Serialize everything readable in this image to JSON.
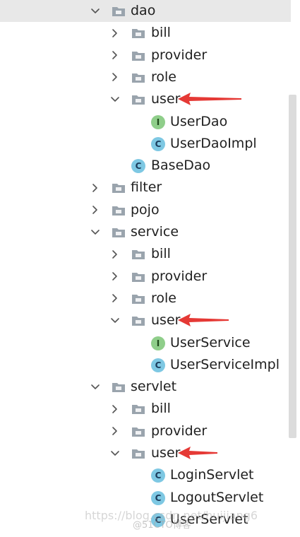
{
  "tree": {
    "nodes": [
      {
        "label": "dao",
        "kind": "folder",
        "depth": 0,
        "expanded": true,
        "selected": true
      },
      {
        "label": "bill",
        "kind": "folder",
        "depth": 1,
        "expanded": false
      },
      {
        "label": "provider",
        "kind": "folder",
        "depth": 1,
        "expanded": false
      },
      {
        "label": "role",
        "kind": "folder",
        "depth": 1,
        "expanded": false
      },
      {
        "label": "user",
        "kind": "folder",
        "depth": 1,
        "expanded": true,
        "annotated": true
      },
      {
        "label": "UserDao",
        "kind": "interface",
        "depth": 2
      },
      {
        "label": "UserDaoImpl",
        "kind": "class",
        "depth": 2
      },
      {
        "label": "BaseDao",
        "kind": "class",
        "depth": 1
      },
      {
        "label": "filter",
        "kind": "folder",
        "depth": 0,
        "expanded": false
      },
      {
        "label": "pojo",
        "kind": "folder",
        "depth": 0,
        "expanded": false
      },
      {
        "label": "service",
        "kind": "folder",
        "depth": 0,
        "expanded": true
      },
      {
        "label": "bill",
        "kind": "folder",
        "depth": 1,
        "expanded": false
      },
      {
        "label": "provider",
        "kind": "folder",
        "depth": 1,
        "expanded": false
      },
      {
        "label": "role",
        "kind": "folder",
        "depth": 1,
        "expanded": false
      },
      {
        "label": "user",
        "kind": "folder",
        "depth": 1,
        "expanded": true,
        "annotated": true
      },
      {
        "label": "UserService",
        "kind": "interface",
        "depth": 2
      },
      {
        "label": "UserServiceImpl",
        "kind": "class",
        "depth": 2
      },
      {
        "label": "servlet",
        "kind": "folder",
        "depth": 0,
        "expanded": true
      },
      {
        "label": "bill",
        "kind": "folder",
        "depth": 1,
        "expanded": false
      },
      {
        "label": "provider",
        "kind": "folder",
        "depth": 1,
        "expanded": false
      },
      {
        "label": "user",
        "kind": "folder",
        "depth": 1,
        "expanded": true,
        "annotated": true
      },
      {
        "label": "LoginServlet",
        "kind": "class",
        "depth": 2
      },
      {
        "label": "LogoutServlet",
        "kind": "class",
        "depth": 2
      },
      {
        "label": "UserServlet",
        "kind": "class",
        "depth": 2
      }
    ],
    "icon_letters": {
      "class": "C",
      "interface": "I"
    }
  },
  "icons": {
    "folder": "folder-icon",
    "class": "class-c-icon",
    "interface": "interface-i-icon",
    "expanded": "chevron-down-icon",
    "collapsed": "chevron-right-icon"
  },
  "colors": {
    "selection": "#e8e8e8",
    "class_icon": "#7ec8e3",
    "interface_icon": "#8fce8a",
    "folder": "#9aa4ad",
    "arrow": "#e53935",
    "scrollbar": "#dcdcdc"
  },
  "watermark": {
    "line1": "https://blog.csdn.net/huijiang6",
    "line2": "@51CTO博客"
  }
}
